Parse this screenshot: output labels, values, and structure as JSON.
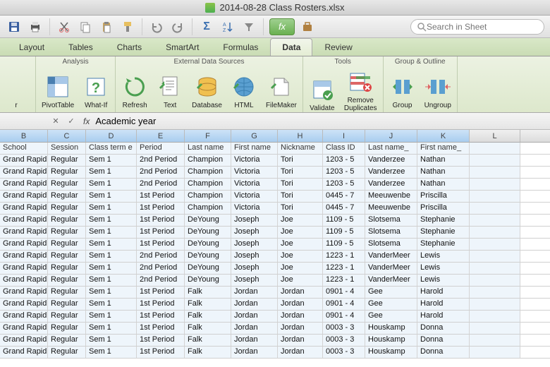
{
  "titlebar": {
    "filename": "2014-08-28 Class Rosters.xlsx"
  },
  "toolbar1": {
    "icons": [
      "save-icon",
      "print-icon",
      "cut-icon",
      "copy-icon",
      "paste-icon",
      "format-painter-icon",
      "undo-icon",
      "redo-icon",
      "autosum-icon",
      "sort-icon",
      "filter-icon",
      "fx-icon",
      "smart-icon"
    ],
    "search_placeholder": "Search in Sheet"
  },
  "tabs": [
    {
      "label": "Layout",
      "active": false
    },
    {
      "label": "Tables",
      "active": false
    },
    {
      "label": "Charts",
      "active": false
    },
    {
      "label": "SmartArt",
      "active": false
    },
    {
      "label": "Formulas",
      "active": false
    },
    {
      "label": "Data",
      "active": true
    },
    {
      "label": "Review",
      "active": false
    }
  ],
  "ribbon_groups": [
    {
      "label": "Analysis",
      "items": [
        {
          "name": "pivottable",
          "label": "PivotTable"
        },
        {
          "name": "whatif",
          "label": "What-If"
        }
      ]
    },
    {
      "label": "External Data Sources",
      "items": [
        {
          "name": "refresh",
          "label": "Refresh"
        },
        {
          "name": "text",
          "label": "Text"
        },
        {
          "name": "database",
          "label": "Database"
        },
        {
          "name": "html",
          "label": "HTML"
        },
        {
          "name": "filemaker",
          "label": "FileMaker"
        }
      ]
    },
    {
      "label": "Tools",
      "items": [
        {
          "name": "validate",
          "label": "Validate"
        },
        {
          "name": "removedup",
          "label": "Remove\nDuplicates"
        }
      ]
    },
    {
      "label": "Group & Outline",
      "items": [
        {
          "name": "group",
          "label": "Group"
        },
        {
          "name": "ungroup",
          "label": "Ungroup"
        }
      ]
    }
  ],
  "formula_bar": {
    "value": "Academic year"
  },
  "columns": [
    {
      "letter": "B",
      "width": "cw-B",
      "header": "School",
      "sel": true
    },
    {
      "letter": "C",
      "width": "cw-C",
      "header": "Session",
      "sel": true
    },
    {
      "letter": "D",
      "width": "cw-D",
      "header": "Class term e",
      "sel": true
    },
    {
      "letter": "E",
      "width": "cw-E",
      "header": "Period",
      "sel": true
    },
    {
      "letter": "F",
      "width": "cw-F",
      "header": "Last name",
      "sel": true
    },
    {
      "letter": "G",
      "width": "cw-G",
      "header": "First name",
      "sel": true
    },
    {
      "letter": "H",
      "width": "cw-H",
      "header": "Nickname",
      "sel": true
    },
    {
      "letter": "I",
      "width": "cw-I",
      "header": "Class ID",
      "sel": true
    },
    {
      "letter": "J",
      "width": "cw-J",
      "header": "Last name_",
      "sel": true
    },
    {
      "letter": "K",
      "width": "cw-K",
      "header": "First name_",
      "sel": true
    },
    {
      "letter": "L",
      "width": "cw-L",
      "header": "",
      "sel": false
    }
  ],
  "rows": [
    [
      "Grand Rapid",
      "Regular",
      "Sem 1",
      "2nd Period",
      "Champion",
      "Victoria",
      "Tori",
      "1203 - 5",
      "Vanderzee",
      "Nathan",
      ""
    ],
    [
      "Grand Rapid",
      "Regular",
      "Sem 1",
      "2nd Period",
      "Champion",
      "Victoria",
      "Tori",
      "1203 - 5",
      "Vanderzee",
      "Nathan",
      ""
    ],
    [
      "Grand Rapid",
      "Regular",
      "Sem 1",
      "2nd Period",
      "Champion",
      "Victoria",
      "Tori",
      "1203 - 5",
      "Vanderzee",
      "Nathan",
      ""
    ],
    [
      "Grand Rapid",
      "Regular",
      "Sem 1",
      "1st Period",
      "Champion",
      "Victoria",
      "Tori",
      "0445 - 7",
      "Meeuwenbe",
      "Priscilla",
      ""
    ],
    [
      "Grand Rapid",
      "Regular",
      "Sem 1",
      "1st Period",
      "Champion",
      "Victoria",
      "Tori",
      "0445 - 7",
      "Meeuwenbe",
      "Priscilla",
      ""
    ],
    [
      "Grand Rapid",
      "Regular",
      "Sem 1",
      "1st Period",
      "DeYoung",
      "Joseph",
      "Joe",
      "1109 - 5",
      "Slotsema",
      "Stephanie",
      ""
    ],
    [
      "Grand Rapid",
      "Regular",
      "Sem 1",
      "1st Period",
      "DeYoung",
      "Joseph",
      "Joe",
      "1109 - 5",
      "Slotsema",
      "Stephanie",
      ""
    ],
    [
      "Grand Rapid",
      "Regular",
      "Sem 1",
      "1st Period",
      "DeYoung",
      "Joseph",
      "Joe",
      "1109 - 5",
      "Slotsema",
      "Stephanie",
      ""
    ],
    [
      "Grand Rapid",
      "Regular",
      "Sem 1",
      "2nd Period",
      "DeYoung",
      "Joseph",
      "Joe",
      "1223 - 1",
      "VanderMeer",
      "Lewis",
      ""
    ],
    [
      "Grand Rapid",
      "Regular",
      "Sem 1",
      "2nd Period",
      "DeYoung",
      "Joseph",
      "Joe",
      "1223 - 1",
      "VanderMeer",
      "Lewis",
      ""
    ],
    [
      "Grand Rapid",
      "Regular",
      "Sem 1",
      "2nd Period",
      "DeYoung",
      "Joseph",
      "Joe",
      "1223 - 1",
      "VanderMeer",
      "Lewis",
      ""
    ],
    [
      "Grand Rapid",
      "Regular",
      "Sem 1",
      "1st Period",
      "Falk",
      "Jordan",
      "Jordan",
      "0901 - 4",
      "Gee",
      "Harold",
      ""
    ],
    [
      "Grand Rapid",
      "Regular",
      "Sem 1",
      "1st Period",
      "Falk",
      "Jordan",
      "Jordan",
      "0901 - 4",
      "Gee",
      "Harold",
      ""
    ],
    [
      "Grand Rapid",
      "Regular",
      "Sem 1",
      "1st Period",
      "Falk",
      "Jordan",
      "Jordan",
      "0901 - 4",
      "Gee",
      "Harold",
      ""
    ],
    [
      "Grand Rapid",
      "Regular",
      "Sem 1",
      "1st Period",
      "Falk",
      "Jordan",
      "Jordan",
      "0003 - 3",
      "Houskamp",
      "Donna",
      ""
    ],
    [
      "Grand Rapid",
      "Regular",
      "Sem 1",
      "1st Period",
      "Falk",
      "Jordan",
      "Jordan",
      "0003 - 3",
      "Houskamp",
      "Donna",
      ""
    ],
    [
      "Grand Rapid",
      "Regular",
      "Sem 1",
      "1st Period",
      "Falk",
      "Jordan",
      "Jordan",
      "0003 - 3",
      "Houskamp",
      "Donna",
      ""
    ]
  ]
}
